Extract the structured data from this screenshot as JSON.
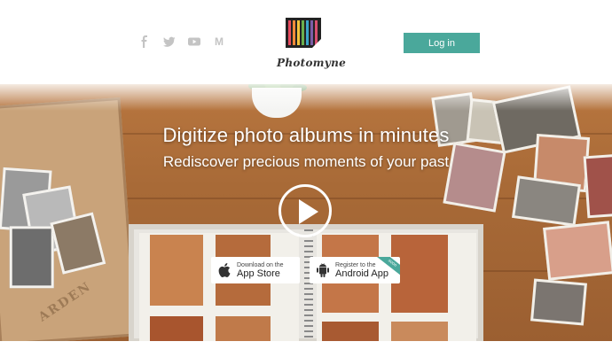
{
  "header": {
    "social_icons": [
      "facebook-icon",
      "twitter-icon",
      "youtube-icon",
      "medium-icon"
    ],
    "medium_glyph": "M",
    "logo_text": "Photomyne",
    "login_label": "Log in"
  },
  "hero": {
    "title": "Digitize photo albums in minutes",
    "subtitle": "Rediscover precious moments of your past",
    "crate_text": "ARDEN",
    "play_icon": "play-icon",
    "app_store": {
      "small": "Download on the",
      "big": "App Store",
      "icon": "apple-icon"
    },
    "android": {
      "small": "Register to the",
      "big": "Android App",
      "badge": "soon",
      "icon": "android-icon"
    }
  },
  "colors": {
    "accent": "#4aa89b",
    "wood": "#a86a37",
    "white": "#ffffff"
  }
}
